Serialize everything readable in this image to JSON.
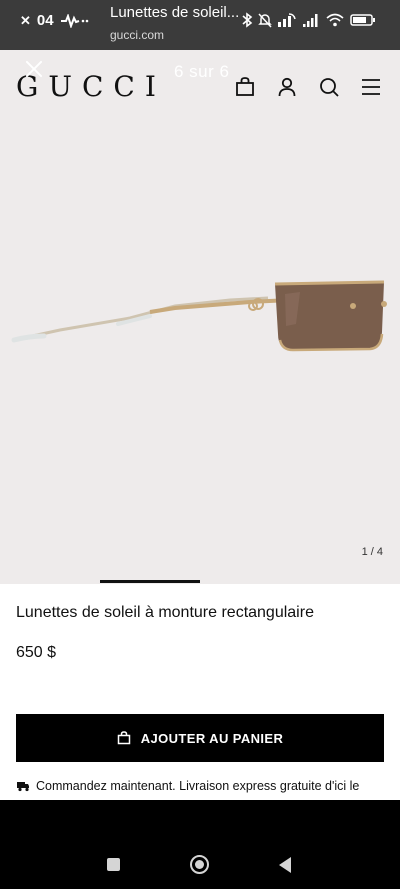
{
  "status_bar": {
    "time": "04",
    "tab_title": "Lunettes de soleil...",
    "domain": "gucci.com"
  },
  "header": {
    "logo": "GUCCI",
    "gallery_counter": "6 sur 6",
    "icons": [
      "shopping-bag-icon",
      "account-icon",
      "search-icon",
      "menu-icon"
    ]
  },
  "gallery": {
    "image_counter": "1 / 4",
    "current_image": 1,
    "total_images": 4
  },
  "product": {
    "title": "Lunettes de soleil à monture rectangulaire",
    "price": "650 $",
    "add_to_cart_label": "AJOUTER AU PANIER",
    "delivery_note": "Commandez maintenant. Livraison express gratuite d'ici le"
  },
  "colors": {
    "status_bar_bg": "#3b3b3b",
    "image_bg": "#eeebeb",
    "button_bg": "#000000",
    "frame_gold": "#c8a97a",
    "lens_brown": "#7a5e4c"
  }
}
